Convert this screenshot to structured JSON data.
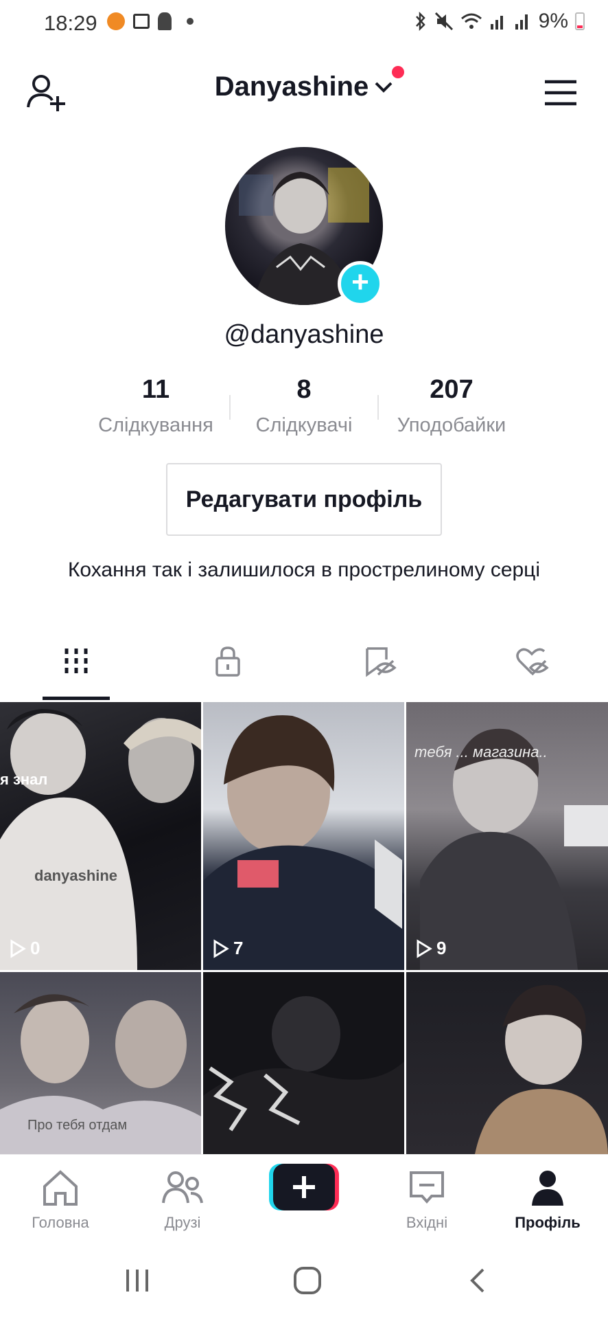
{
  "status_bar": {
    "time": "18:29",
    "battery": "9%"
  },
  "header": {
    "username_title": "Danyashine"
  },
  "profile": {
    "handle": "@danyashine",
    "stats": [
      {
        "value": "11",
        "label": "Слідкування"
      },
      {
        "value": "8",
        "label": "Слідкувачі"
      },
      {
        "value": "207",
        "label": "Уподобайки"
      }
    ],
    "edit_button": "Редагувати профіль",
    "bio": "Кохання так і залишилося в прострелиному серці"
  },
  "tabs": [
    {
      "name": "videos-tab",
      "icon": "grid-icon",
      "active": true
    },
    {
      "name": "private-tab",
      "icon": "lock-icon",
      "active": false
    },
    {
      "name": "reposts-tab",
      "icon": "bookmark-hidden-icon",
      "active": false
    },
    {
      "name": "liked-tab",
      "icon": "heart-hidden-icon",
      "active": false
    }
  ],
  "videos": [
    {
      "views": "0",
      "overlay": "я знал",
      "caption": "danyashine"
    },
    {
      "views": "7",
      "overlay": "",
      "caption": ""
    },
    {
      "views": "9",
      "overlay": "тебя ... магазина..",
      "caption": ""
    },
    {
      "views": "",
      "overlay": "Про тебя отдам",
      "caption": ""
    },
    {
      "views": "",
      "overlay": "",
      "caption": ""
    },
    {
      "views": "",
      "overlay": "",
      "caption": ""
    }
  ],
  "bottom_nav": [
    {
      "label": "Головна",
      "icon": "home-icon"
    },
    {
      "label": "Друзі",
      "icon": "friends-icon"
    },
    {
      "label": "",
      "icon": "create-plus-icon"
    },
    {
      "label": "Вхідні",
      "icon": "inbox-icon"
    },
    {
      "label": "Профіль",
      "icon": "profile-icon",
      "active": true
    }
  ],
  "colors": {
    "accent_red": "#fe2c55",
    "accent_cyan": "#20d5ec",
    "text": "#161823",
    "muted": "#8a8b91"
  }
}
